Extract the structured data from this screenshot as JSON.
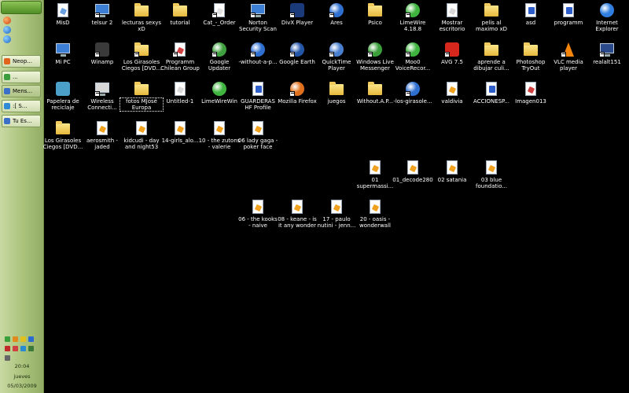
{
  "taskbar": {
    "start_label": "",
    "tasks": [
      {
        "label": "Neop...",
        "color": "#e0641c"
      },
      {
        "label": "...",
        "color": "#3c9d3c"
      },
      {
        "label": "Mens...",
        "color": "#3a6fc7"
      },
      {
        "label": ":[ S...",
        "color": "#2f8bd6"
      },
      {
        "label": "Tu Es...",
        "color": "#3a6fc7"
      }
    ],
    "clock": {
      "time": "20:04",
      "day": "jueves",
      "date": "05/03/2009"
    }
  },
  "desktop": {
    "icons": [
      {
        "label": "MisD",
        "icon": "documents-folder-icon",
        "style": "doc",
        "color": "#6aa0e0"
      },
      {
        "label": "telsur 2",
        "icon": "network-connection-icon",
        "style": "mon",
        "color": "#3d7fd4",
        "shortcut": true
      },
      {
        "label": "lecturas sexys xD",
        "icon": "folder-icon",
        "style": "folder"
      },
      {
        "label": "tutorial",
        "icon": "folder-icon",
        "style": "folder"
      },
      {
        "label": "Cat_-_Order",
        "icon": "document-icon",
        "style": "doc",
        "color": "#e2e2e2",
        "shortcut": true
      },
      {
        "label": "Norton Security Scan",
        "icon": "norton-icon",
        "style": "mon",
        "color": "#3d7fd4",
        "shortcut": true
      },
      {
        "label": "DivX Player",
        "icon": "divx-player-icon",
        "style": "square",
        "color": "#1b3a7a",
        "shortcut": true
      },
      {
        "label": "Ares",
        "icon": "ares-icon",
        "style": "round",
        "color": "#2f6fd0",
        "shortcut": true
      },
      {
        "label": "Psico",
        "icon": "folder-icon",
        "style": "folder"
      },
      {
        "label": "LimeWire 4.18.8",
        "icon": "limewire-icon",
        "style": "round",
        "color": "#3fb43f",
        "shortcut": true
      },
      {
        "label": "Mostrar escritorio",
        "icon": "show-desktop-icon",
        "style": "doc",
        "color": "#d8d8d8"
      },
      {
        "label": "pelis al maximo xD",
        "icon": "folder-icon",
        "style": "folder"
      },
      {
        "label": "asd",
        "icon": "word-document-icon",
        "style": "word"
      },
      {
        "label": "programm",
        "icon": "word-document-icon",
        "style": "word"
      },
      {
        "label": "Internet Explorer",
        "icon": "internet-explorer-icon",
        "style": "round",
        "color": "#2f7ee0"
      },
      {
        "label": "Mi PC",
        "icon": "my-computer-icon",
        "style": "mon",
        "color": "#3d7fd4"
      },
      {
        "label": "Winamp",
        "icon": "winamp-icon",
        "style": "square",
        "color": "#3a3a3a",
        "shortcut": true
      },
      {
        "label": "Los Girasoles Ciegos [DVD...",
        "icon": "folder-icon",
        "style": "folder",
        "shortcut": true
      },
      {
        "label": "Programm Chilean Group",
        "icon": "document-icon",
        "style": "doc",
        "color": "#d04040",
        "shortcut": true
      },
      {
        "label": "Google Updater",
        "icon": "google-updater-icon",
        "style": "round",
        "color": "#3fa03f",
        "shortcut": true
      },
      {
        "label": "-without-a-p...",
        "icon": "ares-file-icon",
        "style": "round",
        "color": "#2f6fd0",
        "shortcut": true
      },
      {
        "label": "Google Earth",
        "icon": "google-earth-icon",
        "style": "round",
        "color": "#2456a8",
        "shortcut": true
      },
      {
        "label": "QuickTime Player",
        "icon": "quicktime-icon",
        "style": "round",
        "color": "#4a7fd0",
        "shortcut": true
      },
      {
        "label": "Windows Live Messenger",
        "icon": "messenger-icon",
        "style": "round",
        "color": "#3a9e3a",
        "shortcut": true
      },
      {
        "label": "Moo0 VoiceRecor...",
        "icon": "voice-recorder-icon",
        "style": "round",
        "color": "#3fb43f",
        "shortcut": true
      },
      {
        "label": "AVG 7.5",
        "icon": "avg-icon",
        "style": "square",
        "color": "#d8281e",
        "shortcut": true
      },
      {
        "label": "aprende a dibujar culi...",
        "icon": "folder-icon",
        "style": "folder"
      },
      {
        "label": "Photoshop TryOut",
        "icon": "folder-icon",
        "style": "folder"
      },
      {
        "label": "VLC media player",
        "icon": "vlc-icon",
        "style": "cone",
        "shortcut": true
      },
      {
        "label": "realalt151",
        "icon": "realplayer-icon",
        "style": "mon",
        "color": "#2a4a8a",
        "shortcut": true
      },
      {
        "label": "Papelera de reciclaje",
        "icon": "recycle-bin-icon",
        "style": "square",
        "color": "#4aa0c8"
      },
      {
        "label": "Wireless Connecti...",
        "icon": "dlink-wireless-icon",
        "style": "mon",
        "color": "#d8d8d8",
        "shortcut": true
      },
      {
        "label": "fotos MJosé Europa",
        "icon": "folder-icon",
        "style": "folder",
        "selected": true
      },
      {
        "label": "Untitled-1",
        "icon": "document-icon",
        "style": "doc",
        "color": "#d8d8d8"
      },
      {
        "label": "LimeWireWin",
        "icon": "limewire-icon",
        "style": "round",
        "color": "#3fb43f"
      },
      {
        "label": "GUARDERAS HF Profile",
        "icon": "word-document-icon",
        "style": "word"
      },
      {
        "label": "Mozilla Firefox",
        "icon": "firefox-icon",
        "style": "round",
        "color": "#e0701c",
        "shortcut": true
      },
      {
        "label": "juegos",
        "icon": "folder-icon",
        "style": "folder"
      },
      {
        "label": "Without.A.P...",
        "icon": "folder-icon",
        "style": "folder"
      },
      {
        "label": "-los-girasole...",
        "icon": "ares-file-icon",
        "style": "round",
        "color": "#2f6fd0",
        "shortcut": true
      },
      {
        "label": "valdivia",
        "icon": "audio-file-icon",
        "style": "doc"
      },
      {
        "label": "ACCIONESP...",
        "icon": "word-document-icon",
        "style": "word"
      },
      {
        "label": "Imagen013",
        "icon": "image-file-icon",
        "style": "doc",
        "color": "#d04040"
      },
      {
        "label": "Los Girasoles Ciegos [DVD...",
        "icon": "folder-icon",
        "style": "folder"
      },
      {
        "label": "aerosmith - jaded",
        "icon": "audio-file-icon",
        "style": "doc"
      },
      {
        "label": "kidcudi - day and night53",
        "icon": "audio-file-icon",
        "style": "doc"
      },
      {
        "label": "14-girls_alo...",
        "icon": "audio-file-icon",
        "style": "doc"
      },
      {
        "label": "10 - the zutons - valerie",
        "icon": "audio-file-icon",
        "style": "doc"
      },
      {
        "label": "06 lady gaga - poker face",
        "icon": "audio-file-icon",
        "style": "doc"
      },
      {
        "label": "01 supermassi...",
        "icon": "audio-file-icon",
        "style": "doc"
      },
      {
        "label": "01_decode280",
        "icon": "audio-file-icon",
        "style": "doc"
      },
      {
        "label": "02 satania",
        "icon": "audio-file-icon",
        "style": "doc"
      },
      {
        "label": "03 blue foundatio...",
        "icon": "audio-file-icon",
        "style": "doc"
      },
      {
        "label": "06 - the kooks - naive",
        "icon": "audio-file-icon",
        "style": "doc"
      },
      {
        "label": "08 - keane - is it any wonder",
        "icon": "audio-file-icon",
        "style": "doc"
      },
      {
        "label": "17 - paulo nutini - jenn...",
        "icon": "audio-file-icon",
        "style": "doc"
      },
      {
        "label": "20 - oasis - wonderwall",
        "icon": "audio-file-icon",
        "style": "doc"
      }
    ]
  }
}
